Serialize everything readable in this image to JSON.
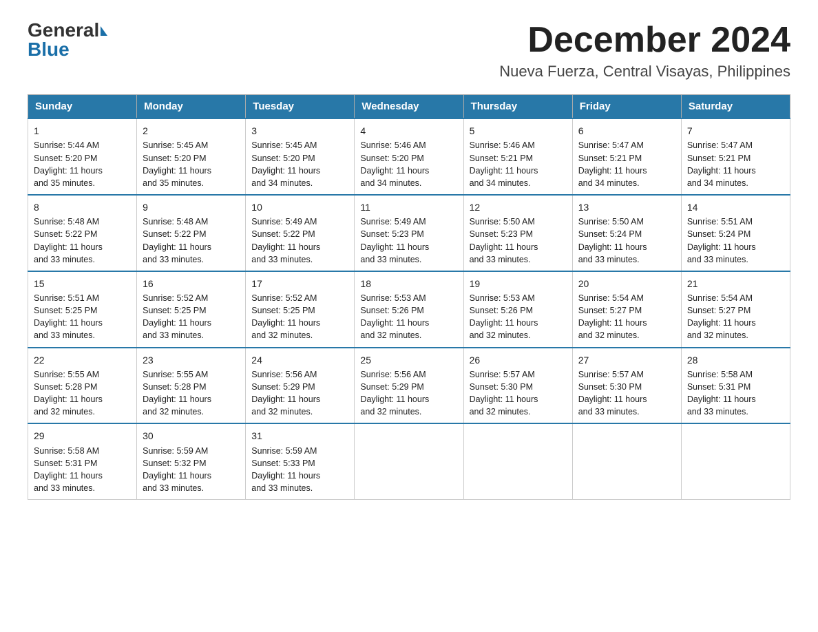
{
  "logo": {
    "general": "General",
    "blue": "Blue"
  },
  "title": "December 2024",
  "location": "Nueva Fuerza, Central Visayas, Philippines",
  "days_of_week": [
    "Sunday",
    "Monday",
    "Tuesday",
    "Wednesday",
    "Thursday",
    "Friday",
    "Saturday"
  ],
  "weeks": [
    [
      {
        "day": "1",
        "sunrise": "5:44 AM",
        "sunset": "5:20 PM",
        "daylight": "11 hours and 35 minutes."
      },
      {
        "day": "2",
        "sunrise": "5:45 AM",
        "sunset": "5:20 PM",
        "daylight": "11 hours and 35 minutes."
      },
      {
        "day": "3",
        "sunrise": "5:45 AM",
        "sunset": "5:20 PM",
        "daylight": "11 hours and 34 minutes."
      },
      {
        "day": "4",
        "sunrise": "5:46 AM",
        "sunset": "5:20 PM",
        "daylight": "11 hours and 34 minutes."
      },
      {
        "day": "5",
        "sunrise": "5:46 AM",
        "sunset": "5:21 PM",
        "daylight": "11 hours and 34 minutes."
      },
      {
        "day": "6",
        "sunrise": "5:47 AM",
        "sunset": "5:21 PM",
        "daylight": "11 hours and 34 minutes."
      },
      {
        "day": "7",
        "sunrise": "5:47 AM",
        "sunset": "5:21 PM",
        "daylight": "11 hours and 34 minutes."
      }
    ],
    [
      {
        "day": "8",
        "sunrise": "5:48 AM",
        "sunset": "5:22 PM",
        "daylight": "11 hours and 33 minutes."
      },
      {
        "day": "9",
        "sunrise": "5:48 AM",
        "sunset": "5:22 PM",
        "daylight": "11 hours and 33 minutes."
      },
      {
        "day": "10",
        "sunrise": "5:49 AM",
        "sunset": "5:22 PM",
        "daylight": "11 hours and 33 minutes."
      },
      {
        "day": "11",
        "sunrise": "5:49 AM",
        "sunset": "5:23 PM",
        "daylight": "11 hours and 33 minutes."
      },
      {
        "day": "12",
        "sunrise": "5:50 AM",
        "sunset": "5:23 PM",
        "daylight": "11 hours and 33 minutes."
      },
      {
        "day": "13",
        "sunrise": "5:50 AM",
        "sunset": "5:24 PM",
        "daylight": "11 hours and 33 minutes."
      },
      {
        "day": "14",
        "sunrise": "5:51 AM",
        "sunset": "5:24 PM",
        "daylight": "11 hours and 33 minutes."
      }
    ],
    [
      {
        "day": "15",
        "sunrise": "5:51 AM",
        "sunset": "5:25 PM",
        "daylight": "11 hours and 33 minutes."
      },
      {
        "day": "16",
        "sunrise": "5:52 AM",
        "sunset": "5:25 PM",
        "daylight": "11 hours and 33 minutes."
      },
      {
        "day": "17",
        "sunrise": "5:52 AM",
        "sunset": "5:25 PM",
        "daylight": "11 hours and 32 minutes."
      },
      {
        "day": "18",
        "sunrise": "5:53 AM",
        "sunset": "5:26 PM",
        "daylight": "11 hours and 32 minutes."
      },
      {
        "day": "19",
        "sunrise": "5:53 AM",
        "sunset": "5:26 PM",
        "daylight": "11 hours and 32 minutes."
      },
      {
        "day": "20",
        "sunrise": "5:54 AM",
        "sunset": "5:27 PM",
        "daylight": "11 hours and 32 minutes."
      },
      {
        "day": "21",
        "sunrise": "5:54 AM",
        "sunset": "5:27 PM",
        "daylight": "11 hours and 32 minutes."
      }
    ],
    [
      {
        "day": "22",
        "sunrise": "5:55 AM",
        "sunset": "5:28 PM",
        "daylight": "11 hours and 32 minutes."
      },
      {
        "day": "23",
        "sunrise": "5:55 AM",
        "sunset": "5:28 PM",
        "daylight": "11 hours and 32 minutes."
      },
      {
        "day": "24",
        "sunrise": "5:56 AM",
        "sunset": "5:29 PM",
        "daylight": "11 hours and 32 minutes."
      },
      {
        "day": "25",
        "sunrise": "5:56 AM",
        "sunset": "5:29 PM",
        "daylight": "11 hours and 32 minutes."
      },
      {
        "day": "26",
        "sunrise": "5:57 AM",
        "sunset": "5:30 PM",
        "daylight": "11 hours and 32 minutes."
      },
      {
        "day": "27",
        "sunrise": "5:57 AM",
        "sunset": "5:30 PM",
        "daylight": "11 hours and 33 minutes."
      },
      {
        "day": "28",
        "sunrise": "5:58 AM",
        "sunset": "5:31 PM",
        "daylight": "11 hours and 33 minutes."
      }
    ],
    [
      {
        "day": "29",
        "sunrise": "5:58 AM",
        "sunset": "5:31 PM",
        "daylight": "11 hours and 33 minutes."
      },
      {
        "day": "30",
        "sunrise": "5:59 AM",
        "sunset": "5:32 PM",
        "daylight": "11 hours and 33 minutes."
      },
      {
        "day": "31",
        "sunrise": "5:59 AM",
        "sunset": "5:33 PM",
        "daylight": "11 hours and 33 minutes."
      },
      null,
      null,
      null,
      null
    ]
  ],
  "labels": {
    "sunrise": "Sunrise:",
    "sunset": "Sunset:",
    "daylight": "Daylight:"
  }
}
